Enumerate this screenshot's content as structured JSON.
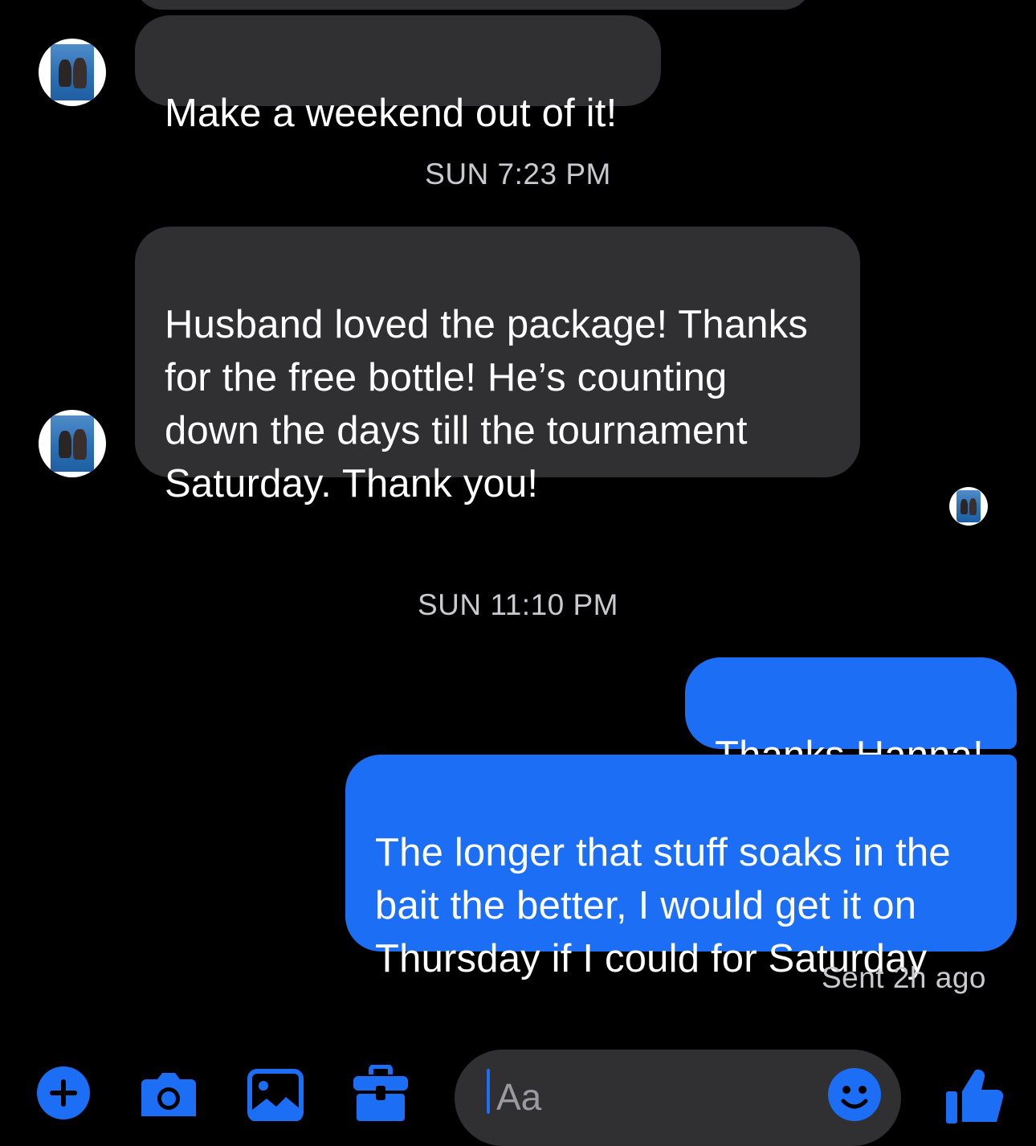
{
  "colors": {
    "background": "#000000",
    "incoming_bubble": "#303032",
    "outgoing_bubble": "#1c6ef5",
    "meta_text": "#c9c9ce",
    "accent": "#1c6ef5"
  },
  "conversation": {
    "messages": {
      "m1": {
        "direction": "incoming",
        "text": "Make a weekend out of it!"
      },
      "m2": {
        "direction": "incoming",
        "text": "Husband loved the package! Thanks\nfor the free bottle! He’s counting\ndown the days till the tournament\nSaturday. Thank you!"
      },
      "m3": {
        "direction": "outgoing",
        "text": "Thanks Hanna!"
      },
      "m4": {
        "direction": "outgoing",
        "text": "The longer that stuff soaks in the\nbait the better,  I would get it on\nThursday if I could for Saturday"
      }
    },
    "timestamps": {
      "t1": "SUN 7:23 PM",
      "t2": "SUN 11:10 PM"
    },
    "sent_status": "Sent 2h ago"
  },
  "composer": {
    "placeholder": "Aa"
  },
  "icons": {
    "toolbar": [
      "plus-circle-icon",
      "camera-icon",
      "gallery-icon",
      "toolbox-icon"
    ],
    "composer": [
      "emoji-icon"
    ],
    "send": "thumbs-up-icon"
  }
}
